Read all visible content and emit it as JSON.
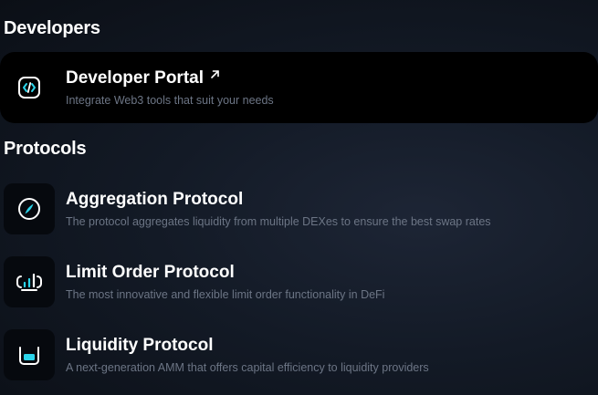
{
  "developers": {
    "heading": "Developers",
    "portal": {
      "title": "Developer Portal",
      "description": "Integrate Web3 tools that suit your needs",
      "icon": "code-icon",
      "external_icon": "external-link-arrow-icon"
    }
  },
  "protocols": {
    "heading": "Protocols",
    "items": [
      {
        "title": "Aggregation Protocol",
        "description": "The protocol aggregates liquidity from multiple DEXes to ensure the best swap rates",
        "icon": "compass-icon"
      },
      {
        "title": "Limit Order Protocol",
        "description": "The most innovative and flexible limit order functionality in DeFi",
        "icon": "chart-bars-icon"
      },
      {
        "title": "Liquidity Protocol",
        "description": "A next-generation AMM that offers capital efficiency to liquidity providers",
        "icon": "liquidity-pool-icon"
      }
    ]
  },
  "colors": {
    "accent": "#2bd4ea",
    "background": "#131a26",
    "highlight": "#000000",
    "description_text": "#6c7585"
  }
}
